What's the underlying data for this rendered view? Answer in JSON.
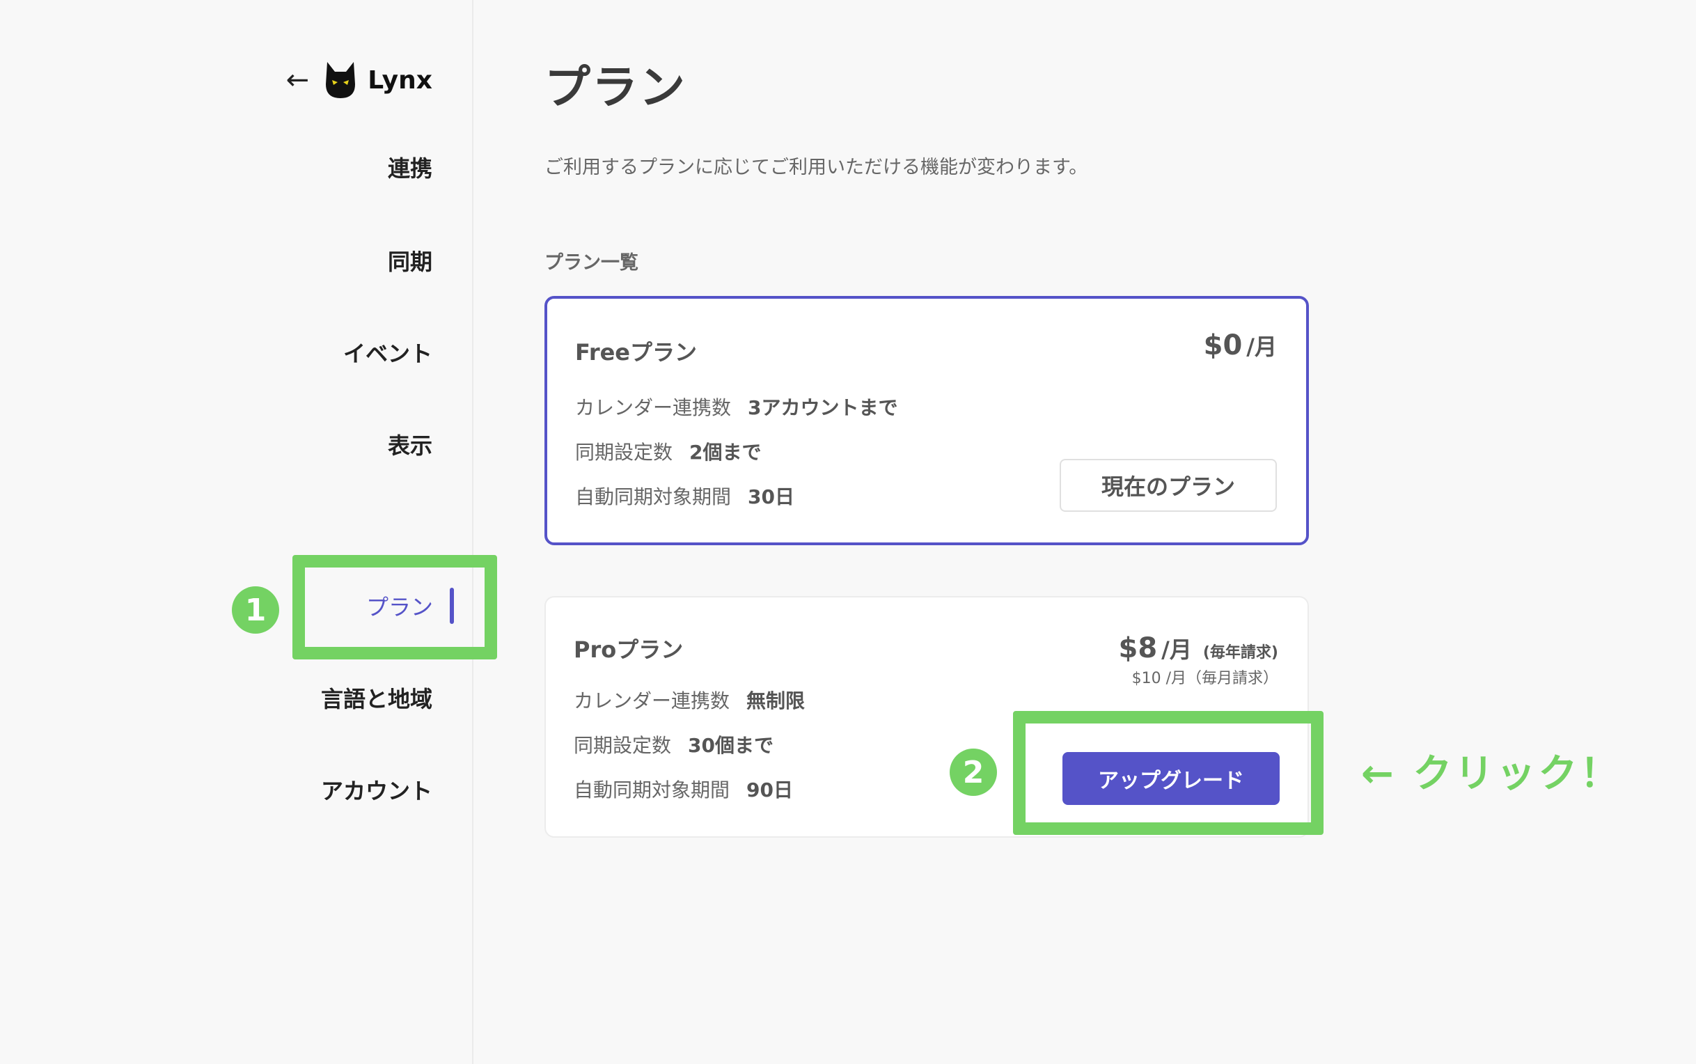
{
  "sidebar": {
    "back_icon": "arrow-left-icon",
    "brand": "Lynx",
    "items": [
      {
        "label": "連携"
      },
      {
        "label": "同期"
      },
      {
        "label": "イベント"
      },
      {
        "label": "表示"
      },
      {
        "label": "プラン",
        "active": true
      },
      {
        "label": "言語と地域"
      },
      {
        "label": "アカウント"
      }
    ]
  },
  "main": {
    "title": "プラン",
    "description": "ご利用するプランに応じてご利用いただける機能が変わります。",
    "section_title": "プラン一覧",
    "plans": [
      {
        "name": "Freeプラン",
        "price": "$0",
        "unit": "/月",
        "features": [
          {
            "label": "カレンダー連携数",
            "value": "3アカウントまで"
          },
          {
            "label": "同期設定数",
            "value": "2個まで"
          },
          {
            "label": "自動同期対象期間",
            "value": "30日"
          }
        ],
        "button_label": "現在のプラン"
      },
      {
        "name": "Proプラン",
        "price": "$8",
        "unit": "/月",
        "price_note": "(毎年請求)",
        "sub_price": "$10 /月（毎月請求）",
        "features": [
          {
            "label": "カレンダー連携数",
            "value": "無制限"
          },
          {
            "label": "同期設定数",
            "value": "30個まで"
          },
          {
            "label": "自動同期対象期間",
            "value": "90日"
          }
        ],
        "button_label": "アップグレード"
      }
    ]
  },
  "annotations": {
    "step1": "1",
    "step2": "2",
    "click_text": "← クリック！"
  },
  "colors": {
    "accent": "#5553c8",
    "highlight": "#74d263",
    "background": "#f8f8f8"
  }
}
